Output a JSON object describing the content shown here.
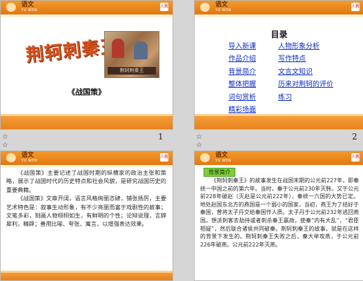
{
  "header": {
    "title": "语文",
    "subtitle": "YU WEN",
    "badge": "人教"
  },
  "slides": [
    {
      "number": "1",
      "marker": "☆",
      "title_art": "荆轲刺秦王",
      "picture_caption": "荆轲刺秦王",
      "book": "《战国策》"
    },
    {
      "number": "2",
      "marker": "☆",
      "toc_title": "目录",
      "toc_left": [
        "导入新课",
        "作品介绍",
        "背景简介",
        "整体把握",
        "词句赏析",
        "精彩场面"
      ],
      "toc_right": [
        "人物形象分析",
        "写作特点",
        "文言文知识",
        "历来对荆轲的评价",
        "练习"
      ]
    },
    {
      "number": "",
      "marker": "☆",
      "paragraphs": [
        "《战国策》主要记述了战国时期的纵横家的政治主张和策略，展示了战国时代的历史特点和社会风貌，是研究战国历史的重要典籍。",
        "《战国策》文章开阔，语言风格绚丽恣肆，铺张扬厉，主要艺术特色是：叙事生动形象，有不少亮丽而富于戏剧性的故事；文笔多彩，刻画人物栩栩如生，有鲜明的个性；论辩说理，言辞犀利，精辟；善用比喻、夸张、寓言，以增强表达效果。"
      ]
    },
    {
      "number": "",
      "marker": "☆",
      "tag": "背景简介",
      "paragraphs": [
        "《荆轲刺秦王》的故事发生在战国末期的公元前227年，即秦统一中国之前的第六年。当时，秦于公元前230年灭韩，又于公元前228年破赵（灭赵是公元前222年），秦统一六国的大势已定。地处赵国东北方的燕国是一个弱小的国家，当初，燕王为了结好于秦国，曾将太子丹交给秦国作人质。太子丹于公元前232年逃回燕国。想派刺客去劫持或者刺杀秦王嬴政，使秦“内有大乱”，“君臣相疑”，然后联合诸侯共同破秦。荆轲刺秦王的故事，就是在这样的背景下发生的。荆轲刺秦王失败之后，秦大举攻燕，于公元前226年破燕。公元前222年灭燕。"
      ]
    }
  ]
}
